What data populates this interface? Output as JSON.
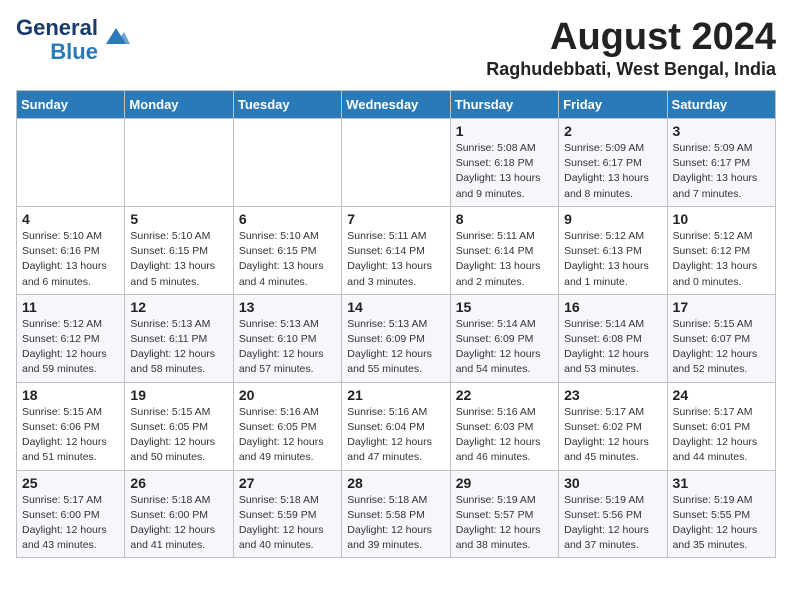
{
  "logo": {
    "line1": "General",
    "line2": "Blue"
  },
  "title": "August 2024",
  "subtitle": "Raghudebbati, West Bengal, India",
  "days_header": [
    "Sunday",
    "Monday",
    "Tuesday",
    "Wednesday",
    "Thursday",
    "Friday",
    "Saturday"
  ],
  "weeks": [
    [
      {
        "day": "",
        "content": ""
      },
      {
        "day": "",
        "content": ""
      },
      {
        "day": "",
        "content": ""
      },
      {
        "day": "",
        "content": ""
      },
      {
        "day": "1",
        "content": "Sunrise: 5:08 AM\nSunset: 6:18 PM\nDaylight: 13 hours\nand 9 minutes."
      },
      {
        "day": "2",
        "content": "Sunrise: 5:09 AM\nSunset: 6:17 PM\nDaylight: 13 hours\nand 8 minutes."
      },
      {
        "day": "3",
        "content": "Sunrise: 5:09 AM\nSunset: 6:17 PM\nDaylight: 13 hours\nand 7 minutes."
      }
    ],
    [
      {
        "day": "4",
        "content": "Sunrise: 5:10 AM\nSunset: 6:16 PM\nDaylight: 13 hours\nand 6 minutes."
      },
      {
        "day": "5",
        "content": "Sunrise: 5:10 AM\nSunset: 6:15 PM\nDaylight: 13 hours\nand 5 minutes."
      },
      {
        "day": "6",
        "content": "Sunrise: 5:10 AM\nSunset: 6:15 PM\nDaylight: 13 hours\nand 4 minutes."
      },
      {
        "day": "7",
        "content": "Sunrise: 5:11 AM\nSunset: 6:14 PM\nDaylight: 13 hours\nand 3 minutes."
      },
      {
        "day": "8",
        "content": "Sunrise: 5:11 AM\nSunset: 6:14 PM\nDaylight: 13 hours\nand 2 minutes."
      },
      {
        "day": "9",
        "content": "Sunrise: 5:12 AM\nSunset: 6:13 PM\nDaylight: 13 hours\nand 1 minute."
      },
      {
        "day": "10",
        "content": "Sunrise: 5:12 AM\nSunset: 6:12 PM\nDaylight: 13 hours\nand 0 minutes."
      }
    ],
    [
      {
        "day": "11",
        "content": "Sunrise: 5:12 AM\nSunset: 6:12 PM\nDaylight: 12 hours\nand 59 minutes."
      },
      {
        "day": "12",
        "content": "Sunrise: 5:13 AM\nSunset: 6:11 PM\nDaylight: 12 hours\nand 58 minutes."
      },
      {
        "day": "13",
        "content": "Sunrise: 5:13 AM\nSunset: 6:10 PM\nDaylight: 12 hours\nand 57 minutes."
      },
      {
        "day": "14",
        "content": "Sunrise: 5:13 AM\nSunset: 6:09 PM\nDaylight: 12 hours\nand 55 minutes."
      },
      {
        "day": "15",
        "content": "Sunrise: 5:14 AM\nSunset: 6:09 PM\nDaylight: 12 hours\nand 54 minutes."
      },
      {
        "day": "16",
        "content": "Sunrise: 5:14 AM\nSunset: 6:08 PM\nDaylight: 12 hours\nand 53 minutes."
      },
      {
        "day": "17",
        "content": "Sunrise: 5:15 AM\nSunset: 6:07 PM\nDaylight: 12 hours\nand 52 minutes."
      }
    ],
    [
      {
        "day": "18",
        "content": "Sunrise: 5:15 AM\nSunset: 6:06 PM\nDaylight: 12 hours\nand 51 minutes."
      },
      {
        "day": "19",
        "content": "Sunrise: 5:15 AM\nSunset: 6:05 PM\nDaylight: 12 hours\nand 50 minutes."
      },
      {
        "day": "20",
        "content": "Sunrise: 5:16 AM\nSunset: 6:05 PM\nDaylight: 12 hours\nand 49 minutes."
      },
      {
        "day": "21",
        "content": "Sunrise: 5:16 AM\nSunset: 6:04 PM\nDaylight: 12 hours\nand 47 minutes."
      },
      {
        "day": "22",
        "content": "Sunrise: 5:16 AM\nSunset: 6:03 PM\nDaylight: 12 hours\nand 46 minutes."
      },
      {
        "day": "23",
        "content": "Sunrise: 5:17 AM\nSunset: 6:02 PM\nDaylight: 12 hours\nand 45 minutes."
      },
      {
        "day": "24",
        "content": "Sunrise: 5:17 AM\nSunset: 6:01 PM\nDaylight: 12 hours\nand 44 minutes."
      }
    ],
    [
      {
        "day": "25",
        "content": "Sunrise: 5:17 AM\nSunset: 6:00 PM\nDaylight: 12 hours\nand 43 minutes."
      },
      {
        "day": "26",
        "content": "Sunrise: 5:18 AM\nSunset: 6:00 PM\nDaylight: 12 hours\nand 41 minutes."
      },
      {
        "day": "27",
        "content": "Sunrise: 5:18 AM\nSunset: 5:59 PM\nDaylight: 12 hours\nand 40 minutes."
      },
      {
        "day": "28",
        "content": "Sunrise: 5:18 AM\nSunset: 5:58 PM\nDaylight: 12 hours\nand 39 minutes."
      },
      {
        "day": "29",
        "content": "Sunrise: 5:19 AM\nSunset: 5:57 PM\nDaylight: 12 hours\nand 38 minutes."
      },
      {
        "day": "30",
        "content": "Sunrise: 5:19 AM\nSunset: 5:56 PM\nDaylight: 12 hours\nand 37 minutes."
      },
      {
        "day": "31",
        "content": "Sunrise: 5:19 AM\nSunset: 5:55 PM\nDaylight: 12 hours\nand 35 minutes."
      }
    ]
  ]
}
